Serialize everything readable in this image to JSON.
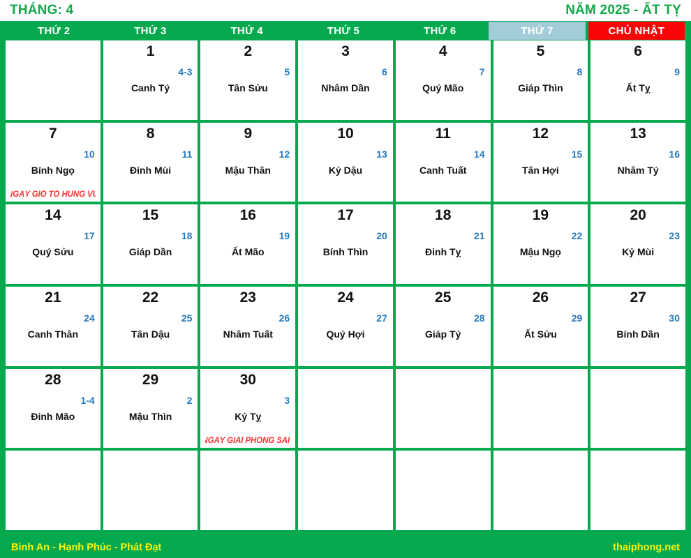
{
  "header": {
    "month_label": "THÁNG: 4",
    "year_label": "NĂM 2025 - ẤT TỴ"
  },
  "weekdays": [
    {
      "label": "THỨ 2",
      "kind": "weekday"
    },
    {
      "label": "THỨ 3",
      "kind": "weekday"
    },
    {
      "label": "THỨ 4",
      "kind": "weekday"
    },
    {
      "label": "THỨ 5",
      "kind": "weekday"
    },
    {
      "label": "THỨ 6",
      "kind": "weekday"
    },
    {
      "label": "THỨ 7",
      "kind": "saturday"
    },
    {
      "label": "CHỦ NHẬT",
      "kind": "sunday"
    }
  ],
  "colors": {
    "brand_green": "#07a94e",
    "title_green": "#15a84b",
    "saturday_blue": "#a3ccd9",
    "sunday_red": "#f90507",
    "lunar_blue": "#2678be",
    "note_red": "#fb3434",
    "footer_yellow": "#f7f511"
  },
  "cells": [
    {
      "solar": "",
      "lunar": "",
      "name": "",
      "note": "",
      "empty": true
    },
    {
      "solar": "1",
      "lunar": "4-3",
      "name": "Canh Tý",
      "note": ""
    },
    {
      "solar": "2",
      "lunar": "5",
      "name": "Tân Sửu",
      "note": ""
    },
    {
      "solar": "3",
      "lunar": "6",
      "name": "Nhâm Dần",
      "note": ""
    },
    {
      "solar": "4",
      "lunar": "7",
      "name": "Quý Mão",
      "note": ""
    },
    {
      "solar": "5",
      "lunar": "8",
      "name": "Giáp Thìn",
      "note": ""
    },
    {
      "solar": "6",
      "lunar": "9",
      "name": "Ất Tỵ",
      "note": ""
    },
    {
      "solar": "7",
      "lunar": "10",
      "name": "Bính Ngọ",
      "note": "NGÀY GIỖ TỔ HÙNG VƯƠNG"
    },
    {
      "solar": "8",
      "lunar": "11",
      "name": "Đinh Mùi",
      "note": ""
    },
    {
      "solar": "9",
      "lunar": "12",
      "name": "Mậu Thân",
      "note": ""
    },
    {
      "solar": "10",
      "lunar": "13",
      "name": "Kỷ Dậu",
      "note": ""
    },
    {
      "solar": "11",
      "lunar": "14",
      "name": "Canh Tuất",
      "note": ""
    },
    {
      "solar": "12",
      "lunar": "15",
      "name": "Tân Hợi",
      "note": ""
    },
    {
      "solar": "13",
      "lunar": "16",
      "name": "Nhâm Tý",
      "note": ""
    },
    {
      "solar": "14",
      "lunar": "17",
      "name": "Quý Sửu",
      "note": ""
    },
    {
      "solar": "15",
      "lunar": "18",
      "name": "Giáp Dần",
      "note": ""
    },
    {
      "solar": "16",
      "lunar": "19",
      "name": "Ất Mão",
      "note": ""
    },
    {
      "solar": "17",
      "lunar": "20",
      "name": "Bính Thìn",
      "note": ""
    },
    {
      "solar": "18",
      "lunar": "21",
      "name": "Đinh Tỵ",
      "note": ""
    },
    {
      "solar": "19",
      "lunar": "22",
      "name": "Mậu Ngọ",
      "note": ""
    },
    {
      "solar": "20",
      "lunar": "23",
      "name": "Kỷ Mùi",
      "note": ""
    },
    {
      "solar": "21",
      "lunar": "24",
      "name": "Canh Thân",
      "note": ""
    },
    {
      "solar": "22",
      "lunar": "25",
      "name": "Tân Dậu",
      "note": ""
    },
    {
      "solar": "23",
      "lunar": "26",
      "name": "Nhâm Tuất",
      "note": ""
    },
    {
      "solar": "24",
      "lunar": "27",
      "name": "Quý Hợi",
      "note": ""
    },
    {
      "solar": "25",
      "lunar": "28",
      "name": "Giáp Tý",
      "note": ""
    },
    {
      "solar": "26",
      "lunar": "29",
      "name": "Ất Sửu",
      "note": ""
    },
    {
      "solar": "27",
      "lunar": "30",
      "name": "Bính Dần",
      "note": ""
    },
    {
      "solar": "28",
      "lunar": "1-4",
      "name": "Đinh Mão",
      "note": ""
    },
    {
      "solar": "29",
      "lunar": "2",
      "name": "Mậu Thìn",
      "note": ""
    },
    {
      "solar": "30",
      "lunar": "3",
      "name": "Kỷ Tỵ",
      "note": "NGÀY GIẢI PHÓNG SÀI GÒN"
    },
    {
      "solar": "",
      "lunar": "",
      "name": "",
      "note": "",
      "empty": true
    },
    {
      "solar": "",
      "lunar": "",
      "name": "",
      "note": "",
      "empty": true
    },
    {
      "solar": "",
      "lunar": "",
      "name": "",
      "note": "",
      "empty": true
    },
    {
      "solar": "",
      "lunar": "",
      "name": "",
      "note": "",
      "empty": true
    },
    {
      "solar": "",
      "lunar": "",
      "name": "",
      "note": "",
      "empty": true
    },
    {
      "solar": "",
      "lunar": "",
      "name": "",
      "note": "",
      "empty": true
    },
    {
      "solar": "",
      "lunar": "",
      "name": "",
      "note": "",
      "empty": true
    },
    {
      "solar": "",
      "lunar": "",
      "name": "",
      "note": "",
      "empty": true
    },
    {
      "solar": "",
      "lunar": "",
      "name": "",
      "note": "",
      "empty": true
    },
    {
      "solar": "",
      "lunar": "",
      "name": "",
      "note": "",
      "empty": true
    },
    {
      "solar": "",
      "lunar": "",
      "name": "",
      "note": "",
      "empty": true
    }
  ],
  "footer": {
    "left_text": "Bình An - Hạnh Phúc - Phát Đạt",
    "right_text": "thaiphong.net"
  }
}
